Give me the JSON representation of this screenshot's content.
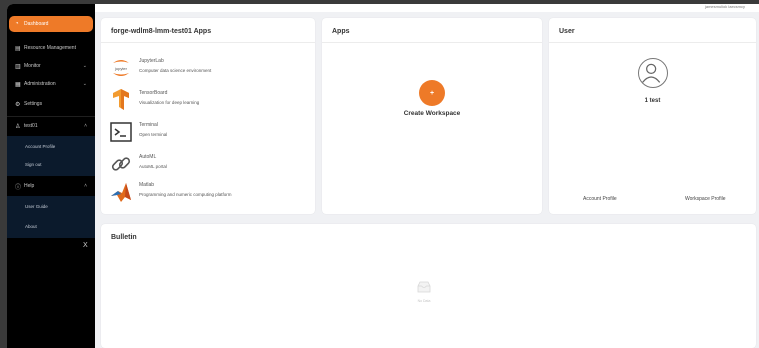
{
  "topbar": {
    "link": "jamesmuliok laecsmcy"
  },
  "sidebar": {
    "items": [
      {
        "label": "Dashboard",
        "icon": "clock-icon"
      },
      {
        "label": "Resource Management",
        "icon": "database-icon"
      },
      {
        "label": "Monitor",
        "icon": "chart-icon"
      },
      {
        "label": "Administration",
        "icon": "admin-icon"
      },
      {
        "label": "Settings",
        "icon": "settings-icon"
      },
      {
        "label": "test01",
        "icon": "user-icon"
      },
      {
        "label": "Help",
        "icon": "help-icon"
      }
    ],
    "user_sub": [
      "Account Profile",
      "Sign out"
    ],
    "help_sub": [
      "User Guide",
      "About"
    ],
    "collapse": "X",
    "active_color": "#ee7a28"
  },
  "apps_card": {
    "title": "forge-wdlm8-lmm-test01 Apps",
    "apps": [
      {
        "name": "JupyterLab",
        "desc": "Computer data science environment",
        "icon": "jupyter-icon"
      },
      {
        "name": "TensorBoard",
        "desc": "Visualization for deep learning",
        "icon": "tensorflow-icon"
      },
      {
        "name": "Terminal",
        "desc": "Open terminal",
        "icon": "terminal-icon"
      },
      {
        "name": "AutoML",
        "desc": "AutoML portal",
        "icon": "link-icon"
      },
      {
        "name": "Matlab",
        "desc": "Programming and numeric computing platform",
        "icon": "matlab-icon"
      }
    ]
  },
  "apps_panel": {
    "title": "Apps",
    "create_label": "Create Workspace",
    "plus": "+"
  },
  "user_card": {
    "title": "User",
    "name": "1 test",
    "account_link": "Account Profile",
    "workspace_link": "Workspace Profile"
  },
  "bulletin": {
    "title": "Bulletin",
    "empty_label": "No Data"
  }
}
